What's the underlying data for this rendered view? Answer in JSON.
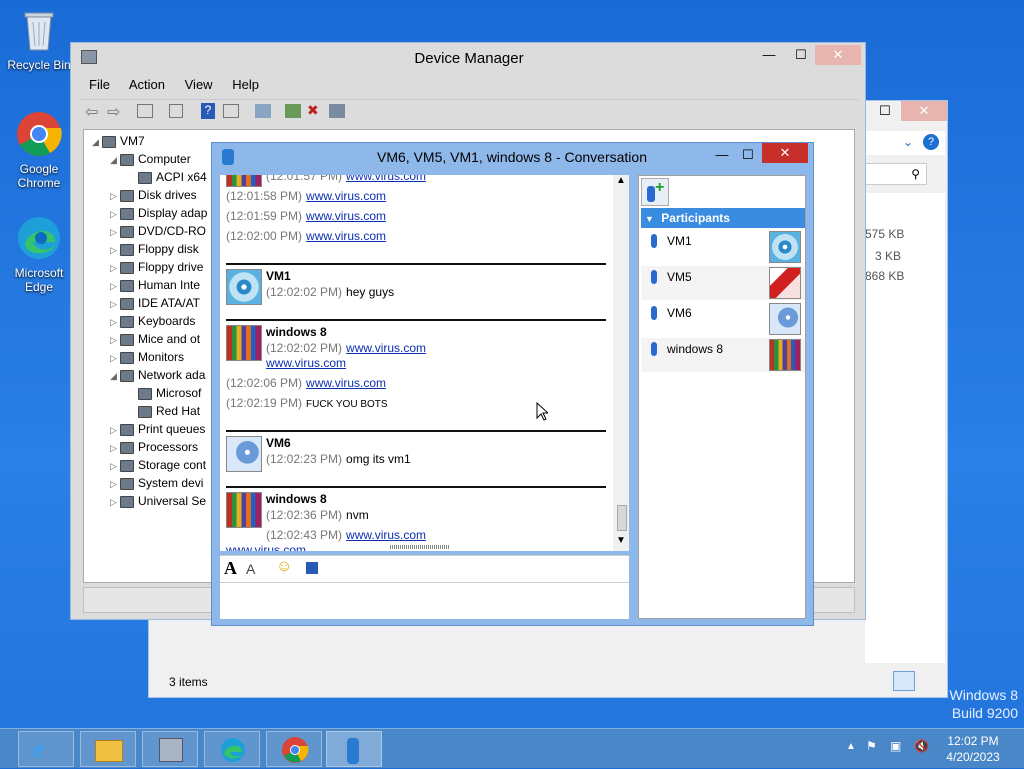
{
  "desktop": {
    "icons": [
      {
        "label": "Recycle Bin"
      },
      {
        "label": "Google Chrome"
      },
      {
        "label": "Microsoft Edge"
      }
    ],
    "watermark": [
      "Windows 8",
      "Build 9200"
    ]
  },
  "explorer": {
    "sizes": [
      "575 KB",
      "3 KB",
      "868 KB"
    ],
    "status": "3 items"
  },
  "devmgr": {
    "title": "Device Manager",
    "menu": [
      "File",
      "Action",
      "View",
      "Help"
    ],
    "tree": [
      {
        "label": "VM7",
        "indent": 0
      },
      {
        "label": "Computer",
        "indent": 1
      },
      {
        "label": "ACPI x64",
        "indent": 2
      },
      {
        "label": "Disk drives",
        "indent": 1
      },
      {
        "label": "Display adap",
        "indent": 1
      },
      {
        "label": "DVD/CD-RO",
        "indent": 1
      },
      {
        "label": "Floppy disk",
        "indent": 1
      },
      {
        "label": "Floppy drive",
        "indent": 1
      },
      {
        "label": "Human Inte",
        "indent": 1
      },
      {
        "label": "IDE ATA/AT",
        "indent": 1
      },
      {
        "label": "Keyboards",
        "indent": 1
      },
      {
        "label": "Mice and ot",
        "indent": 1
      },
      {
        "label": "Monitors",
        "indent": 1
      },
      {
        "label": "Network ada",
        "indent": 1
      },
      {
        "label": "Microsof",
        "indent": 2
      },
      {
        "label": "Red Hat",
        "indent": 2
      },
      {
        "label": "Print queues",
        "indent": 1
      },
      {
        "label": "Processors",
        "indent": 1
      },
      {
        "label": "Storage cont",
        "indent": 1
      },
      {
        "label": "System devi",
        "indent": 1
      },
      {
        "label": "Universal Se",
        "indent": 1
      }
    ]
  },
  "conv": {
    "title": "VM6, VM5, VM1, windows 8 - Conversation",
    "messages": [
      {
        "ts": "(12:01:57 PM)",
        "text": "www.virus.com",
        "link": true
      },
      {
        "ts": "(12:01:58 PM)",
        "text": "www.virus.com",
        "link": true
      },
      {
        "ts": "(12:01:59 PM)",
        "text": "www.virus.com",
        "link": true
      },
      {
        "ts": "(12:02:00 PM)",
        "text": "www.virus.com",
        "link": true
      },
      {
        "user": "VM1",
        "ts": "(12:02:02 PM)",
        "text": "hey guys",
        "link": false
      },
      {
        "user": "windows 8",
        "ts": "(12:02:02 PM)",
        "text": "www.virus.com",
        "link": true,
        "extra": "www.virus.com"
      },
      {
        "ts": "(12:02:06 PM)",
        "text": "www.virus.com",
        "link": true
      },
      {
        "ts": "(12:02:19 PM)",
        "text": "FUCK YOU BOTS",
        "link": false
      },
      {
        "user": "VM6",
        "ts": "(12:02:23 PM)",
        "text": "omg its vm1",
        "link": false
      },
      {
        "user": "windows 8",
        "ts": "(12:02:36 PM)",
        "text": "nvm",
        "link": false
      },
      {
        "ts": "(12:02:43 PM)",
        "text": "www.virus.com",
        "link": true,
        "extra": "www.virus.com"
      }
    ],
    "participants_label": "Participants",
    "participants": [
      "VM1",
      "VM5",
      "VM6",
      "windows 8"
    ]
  },
  "taskbar": {
    "time": "12:02 PM",
    "date": "4/20/2023"
  }
}
